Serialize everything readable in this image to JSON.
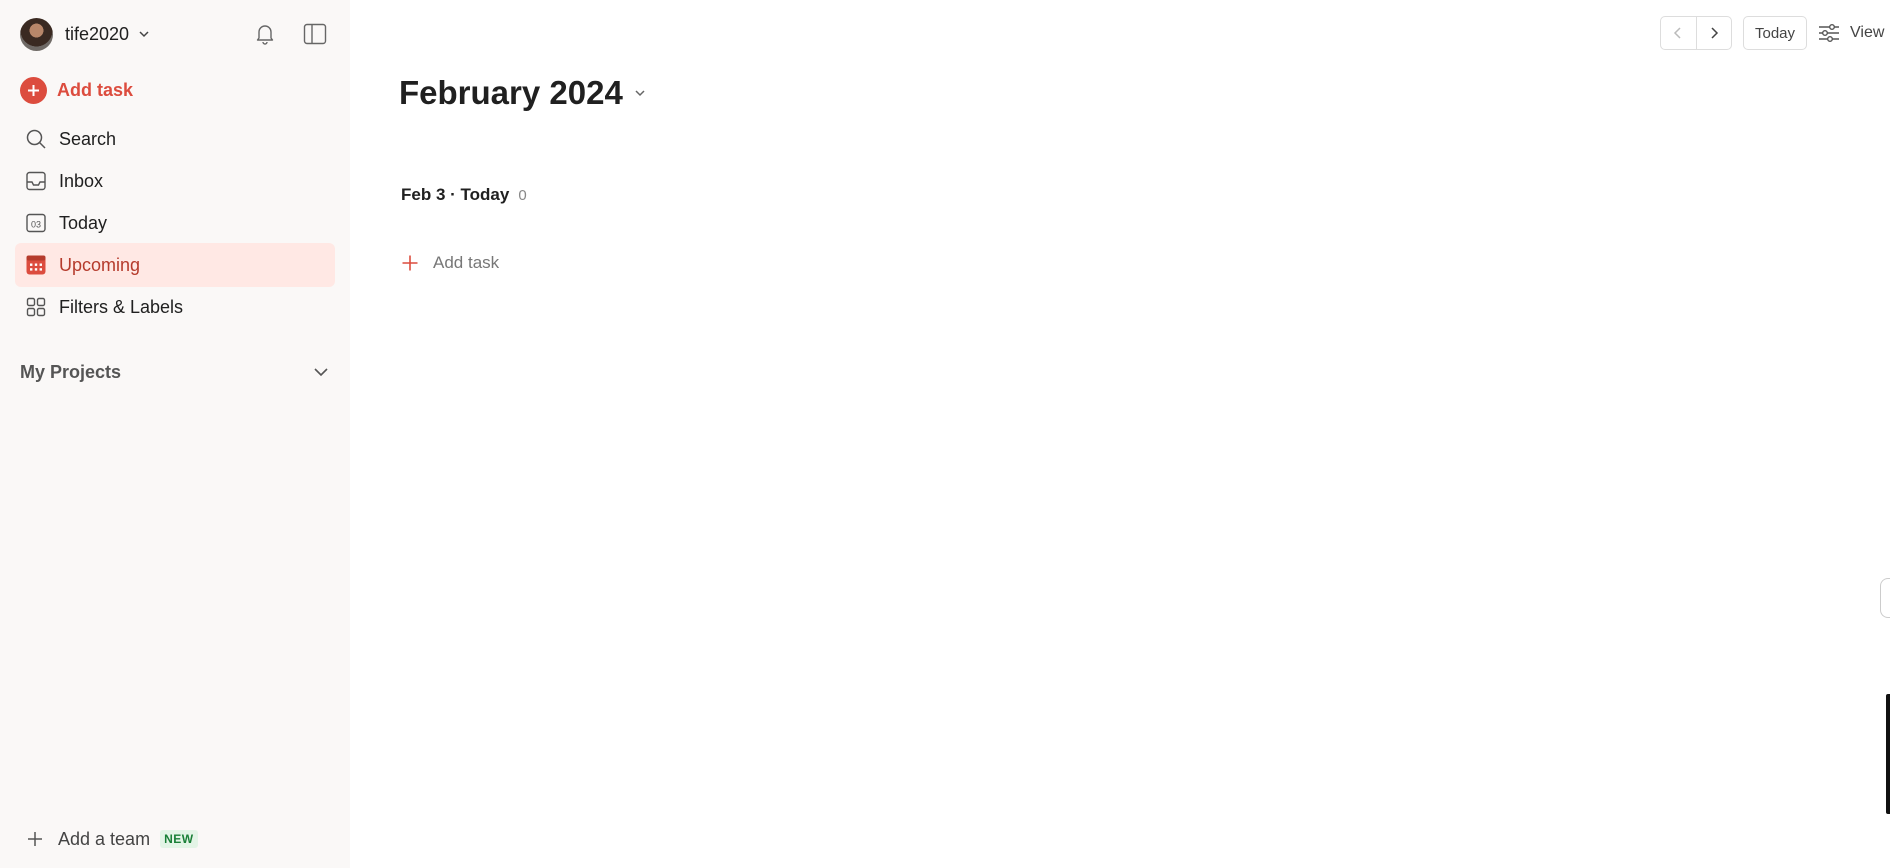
{
  "sidebar": {
    "user": {
      "name": "tife2020"
    },
    "add_task": "Add task",
    "nav": [
      {
        "label": "Search",
        "icon": "search-icon"
      },
      {
        "label": "Inbox",
        "icon": "inbox-icon"
      },
      {
        "label": "Today",
        "icon": "calendar-today-icon",
        "icon_text": "03"
      },
      {
        "label": "Upcoming",
        "icon": "calendar-upcoming-icon",
        "active": true
      },
      {
        "label": "Filters & Labels",
        "icon": "grid-icon"
      }
    ],
    "projects_label": "My Projects",
    "add_team": "Add a team",
    "new_badge": "NEW"
  },
  "toolbar": {
    "today": "Today",
    "view": "View"
  },
  "main": {
    "month": "February 2024",
    "day_label": "Feb 3 · Today",
    "day_count": "0",
    "add_task": "Add task"
  },
  "colors": {
    "accent": "#dc4c3e",
    "active_bg": "#ffe8e4",
    "sidebar_bg": "#faf8f7"
  }
}
